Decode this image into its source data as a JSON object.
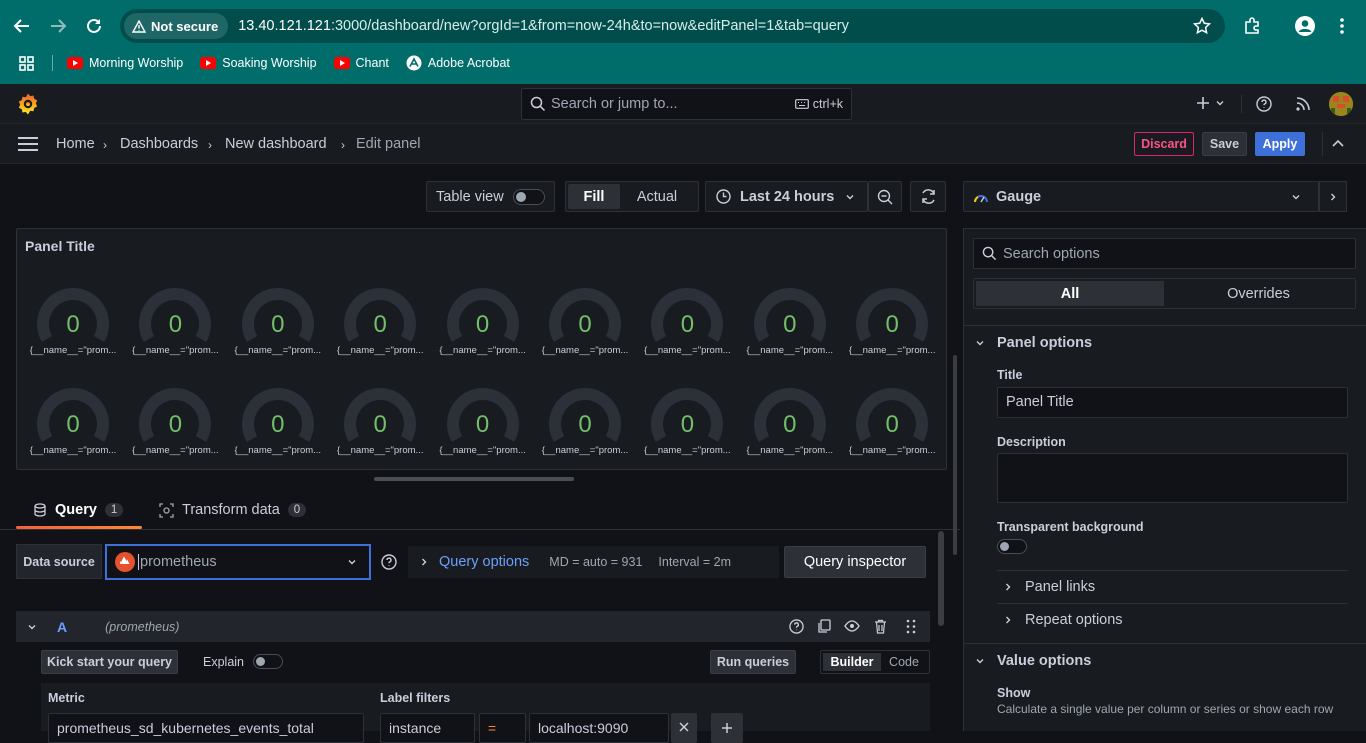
{
  "browser": {
    "not_secure": "Not secure",
    "url_host": "13.40.121.121",
    "url_rest": ":3000/dashboard/new?orgId=1&from=now-24h&to=now&editPanel=1&tab=query",
    "bookmarks": [
      {
        "label": "Morning Worship",
        "icon": "youtube-icon"
      },
      {
        "label": "Soaking Worship",
        "icon": "youtube-icon"
      },
      {
        "label": "Chant",
        "icon": "youtube-icon"
      },
      {
        "label": "Adobe Acrobat",
        "icon": "acrobat-icon"
      }
    ]
  },
  "topbar": {
    "search_placeholder": "Search or jump to...",
    "search_shortcut": "ctrl+k"
  },
  "breadcrumb": {
    "home": "Home",
    "dashboards": "Dashboards",
    "new_dashboard": "New dashboard",
    "current": "Edit panel"
  },
  "actions": {
    "discard": "Discard",
    "save": "Save",
    "apply": "Apply"
  },
  "toolbar": {
    "table_view": "Table view",
    "fill": "Fill",
    "actual": "Actual",
    "time_range": "Last 24 hours"
  },
  "panel": {
    "title": "Panel Title",
    "gauges": [
      {
        "value": "0",
        "label": "{__name__=\"prom..."
      },
      {
        "value": "0",
        "label": "{__name__=\"prom..."
      },
      {
        "value": "0",
        "label": "{__name__=\"prom..."
      },
      {
        "value": "0",
        "label": "{__name__=\"prom..."
      },
      {
        "value": "0",
        "label": "{__name__=\"prom..."
      },
      {
        "value": "0",
        "label": "{__name__=\"prom..."
      },
      {
        "value": "0",
        "label": "{__name__=\"prom..."
      },
      {
        "value": "0",
        "label": "{__name__=\"prom..."
      },
      {
        "value": "0",
        "label": "{__name__=\"prom..."
      },
      {
        "value": "0",
        "label": "{__name__=\"prom..."
      },
      {
        "value": "0",
        "label": "{__name__=\"prom..."
      },
      {
        "value": "0",
        "label": "{__name__=\"prom..."
      },
      {
        "value": "0",
        "label": "{__name__=\"prom..."
      },
      {
        "value": "0",
        "label": "{__name__=\"prom..."
      },
      {
        "value": "0",
        "label": "{__name__=\"prom..."
      },
      {
        "value": "0",
        "label": "{__name__=\"prom..."
      },
      {
        "value": "0",
        "label": "{__name__=\"prom..."
      },
      {
        "value": "0",
        "label": "{__name__=\"prom..."
      }
    ]
  },
  "query_tabs": {
    "query": "Query",
    "query_count": "1",
    "transform": "Transform data",
    "transform_count": "0"
  },
  "query": {
    "data_source_label": "Data source",
    "data_source_value": "prometheus",
    "query_options": "Query options",
    "md": "MD = auto = 931",
    "interval": "Interval = 2m",
    "query_inspector": "Query inspector",
    "row_letter": "A",
    "row_source": "(prometheus)",
    "kick_start": "Kick start your query",
    "explain": "Explain",
    "run_queries": "Run queries",
    "builder": "Builder",
    "code": "Code",
    "metric_label": "Metric",
    "metric_value": "prometheus_sd_kubernetes_events_total",
    "label_filters": "Label filters",
    "filter_label": "instance",
    "filter_op": "=",
    "filter_value": "localhost:9090"
  },
  "options": {
    "viz": "Gauge",
    "search_placeholder": "Search options",
    "tab_all": "All",
    "tab_overrides": "Overrides",
    "panel_options": "Panel options",
    "title_label": "Title",
    "title_value": "Panel Title",
    "description_label": "Description",
    "transparent_label": "Transparent background",
    "panel_links": "Panel links",
    "repeat_options": "Repeat options",
    "value_options": "Value options",
    "show_label": "Show",
    "show_desc": "Calculate a single value per column or series or show each row"
  },
  "colors": {
    "accent": "#3d71d9",
    "gauge_value": "#73bf69",
    "discard": "#e0226e",
    "chrome": "#006d6b",
    "query_options": "#6e9fff"
  }
}
